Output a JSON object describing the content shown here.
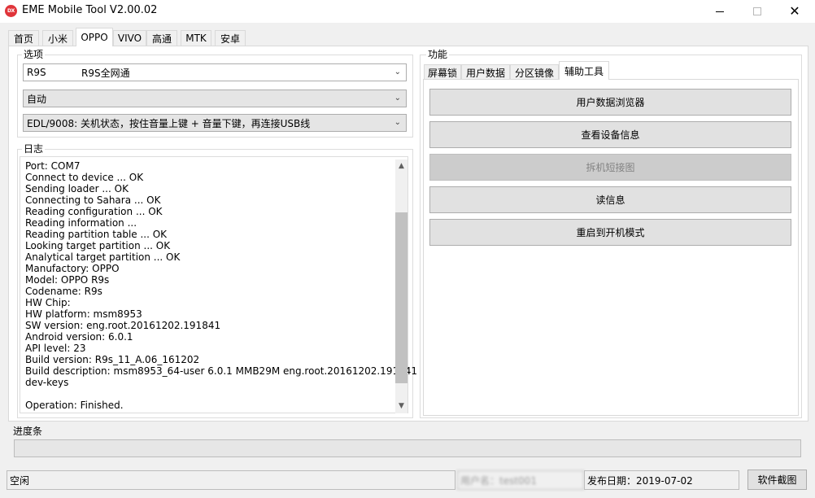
{
  "window": {
    "app_icon_text": "DX",
    "title": "EME Mobile Tool V2.00.02",
    "icons": {
      "minimize": "minimize-icon",
      "maximize": "maximize-icon",
      "close": "close-icon"
    }
  },
  "top_tabs": [
    "首页",
    "小米",
    "OPPO",
    "VIVO",
    "高通",
    "MTK",
    "安卓"
  ],
  "active_top_tab": "OPPO",
  "options": {
    "label": "选项",
    "model_code": "R9S",
    "model_name": "R9S全网通",
    "mode": "自动",
    "connect_method": "EDL/9008: 关机状态，按住音量上键 + 音量下键，再连接USB线"
  },
  "log": {
    "label": "日志",
    "lines": [
      "Port: COM7",
      "Connect to device ... OK",
      "Sending loader ... OK",
      "Connecting to Sahara ... OK",
      "Reading configuration ... OK",
      "Reading information ...",
      "Reading partition table ... OK",
      "Looking target partition ... OK",
      "Analytical target partition ... OK",
      "Manufactory: OPPO",
      "Model: OPPO R9s",
      "Codename: R9s",
      "HW Chip:",
      "HW platform: msm8953",
      "SW version: eng.root.20161202.191841",
      "Android version: 6.0.1",
      "API level: 23",
      "Build version: R9s_11_A.06_161202",
      "Build description: msm8953_64-user 6.0.1 MMB29M eng.root.20161202.191841",
      "dev-keys",
      "",
      "Operation: Finished."
    ]
  },
  "functions": {
    "label": "功能",
    "tabs": [
      "屏幕锁",
      "用户数据",
      "分区镜像",
      "辅助工具"
    ],
    "active_tab": "辅助工具",
    "buttons": [
      {
        "label": "用户数据浏览器",
        "enabled": true
      },
      {
        "label": "查看设备信息",
        "enabled": true
      },
      {
        "label": "拆机短接图",
        "enabled": false
      },
      {
        "label": "读信息",
        "enabled": true
      },
      {
        "label": "重启到开机模式",
        "enabled": true
      }
    ]
  },
  "progress": {
    "label": "进度条",
    "value": 0
  },
  "status_bar": {
    "state": "空闲",
    "user": "用户名：test001",
    "release_date": "发布日期：2019-07-02",
    "screenshot_button": "软件截图"
  }
}
